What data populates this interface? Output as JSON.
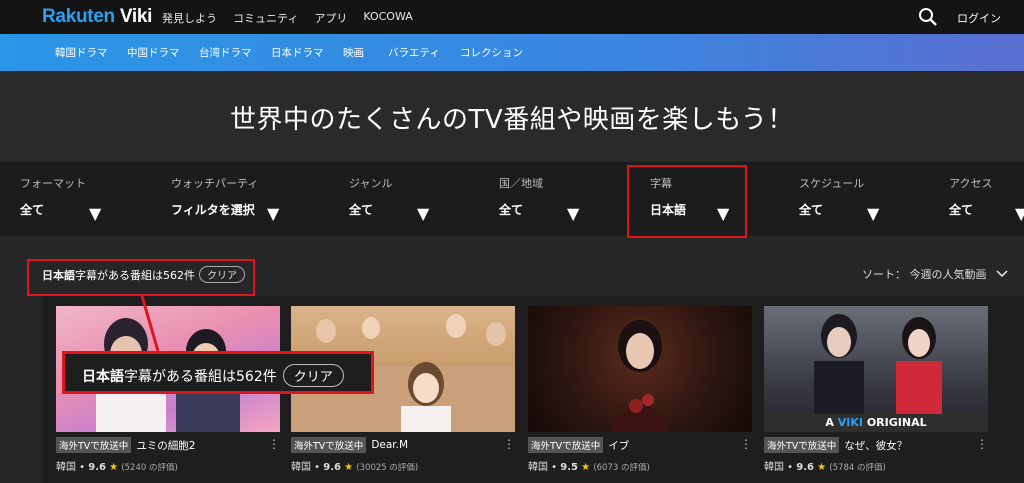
{
  "brand": {
    "part1": "Rakuten",
    "part2": "Viki"
  },
  "topnav": [
    "発見しよう",
    "コミュニティ",
    "アプリ",
    "KOCOWA"
  ],
  "login": "ログイン",
  "genres": [
    "韓国ドラマ",
    "中国ドラマ",
    "台湾ドラマ",
    "日本ドラマ",
    "映画",
    "バラエティ",
    "コレクション"
  ],
  "hero_title": "世界中のたくさんのTV番組や映画を楽しもう！",
  "filters": [
    {
      "label": "フォーマット",
      "value": "全て"
    },
    {
      "label": "ウォッチパーティ",
      "value": "フィルタを選択"
    },
    {
      "label": "ジャンル",
      "value": "全て"
    },
    {
      "label": "国／地域",
      "value": "全て"
    },
    {
      "label": "字幕",
      "value": "日本語"
    },
    {
      "label": "スケジュール",
      "value": "全て"
    },
    {
      "label": "アクセス",
      "value": "全て"
    }
  ],
  "results": {
    "lang": "日本語",
    "rest": "字幕がある番組は562件",
    "clear": "クリア"
  },
  "sort": "ソート： 今週の人気動画",
  "callout": {
    "lang": "日本語",
    "rest": "字幕がある番組は562件",
    "clear": "クリア"
  },
  "cards": [
    {
      "badge": "海外TVで放送中",
      "title": "ユミの細胞2",
      "country": "韓国",
      "rating": "9.6",
      "reviews": "(5240 の評価)"
    },
    {
      "badge": "海外TVで放送中",
      "title": "Dear.M",
      "country": "韓国",
      "rating": "9.6",
      "reviews": "(30025 の評価)"
    },
    {
      "badge": "海外TVで放送中",
      "title": "イブ",
      "country": "韓国",
      "rating": "9.5",
      "reviews": "(6073 の評価)"
    },
    {
      "badge": "海外TVで放送中",
      "title": "なぜ、彼女？",
      "country": "韓国",
      "rating": "9.6",
      "reviews": "(5784 の評価)"
    }
  ],
  "viki_original": {
    "a": "A",
    "viki": "VIKI",
    "original": "ORIGINAL"
  },
  "colors": {
    "accent_blue": "#2c9ff0",
    "highlight_red": "#e0141e",
    "star": "#f5c518"
  }
}
